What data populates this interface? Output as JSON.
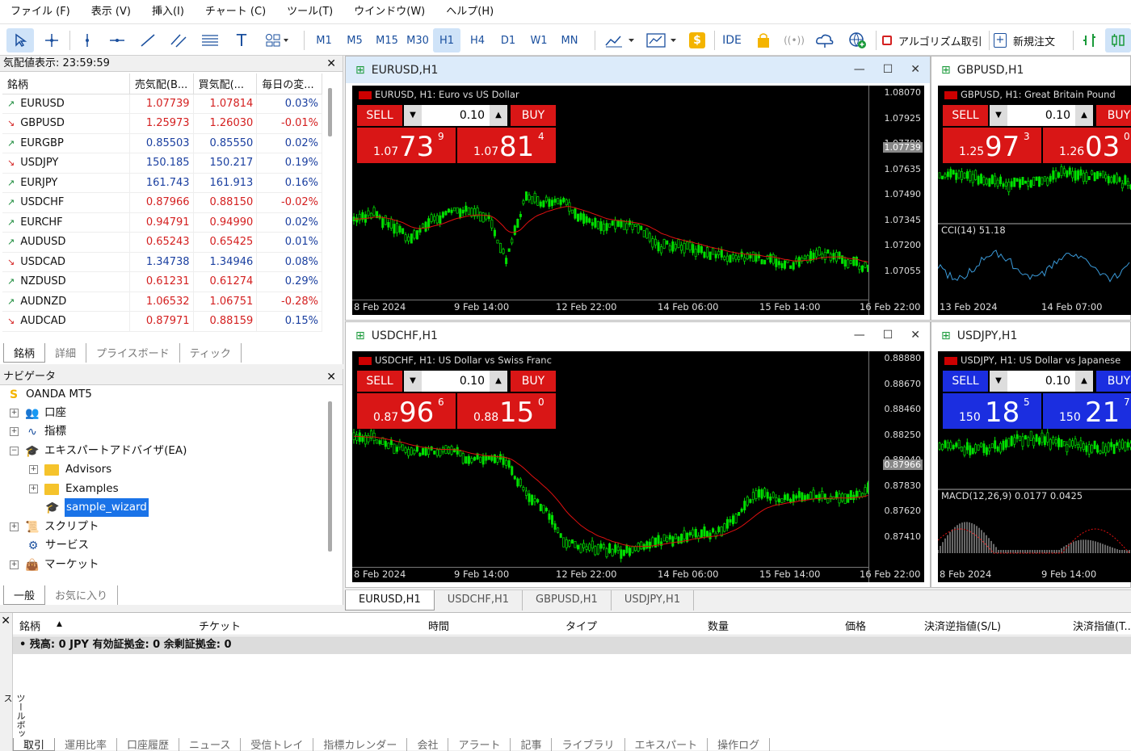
{
  "menu": [
    "ファイル (F)",
    "表示 (V)",
    "挿入(I)",
    "チャート (C)",
    "ツール(T)",
    "ウインドウ(W)",
    "ヘルプ(H)"
  ],
  "toolbar": {
    "timeframes": [
      "M1",
      "M5",
      "M15",
      "M30",
      "H1",
      "H4",
      "D1",
      "W1",
      "MN"
    ],
    "active_tf": "H1",
    "ide_label": "IDE",
    "algo_label": "アルゴリズム取引",
    "new_order_label": "新規注文",
    "accent": "#1a4f9e"
  },
  "watch": {
    "title": "気配値表示: 23:59:59",
    "headers": [
      "銘柄",
      "売気配(B...",
      "買気配(...",
      "毎日の変..."
    ],
    "rows": [
      {
        "dir": "up",
        "sym": "EURUSD",
        "bid": "1.07739",
        "ask": "1.07814",
        "chg": "0.03%"
      },
      {
        "dir": "dn",
        "sym": "GBPUSD",
        "bid": "1.25973",
        "ask": "1.26030",
        "chg": "-0.01%"
      },
      {
        "dir": "up",
        "sym": "EURGBP",
        "bid": "0.85503",
        "ask": "0.85550",
        "chg": "0.02%"
      },
      {
        "dir": "dn",
        "sym": "USDJPY",
        "bid": "150.185",
        "ask": "150.217",
        "chg": "0.19%"
      },
      {
        "dir": "up",
        "sym": "EURJPY",
        "bid": "161.743",
        "ask": "161.913",
        "chg": "0.16%"
      },
      {
        "dir": "up",
        "sym": "USDCHF",
        "bid": "0.87966",
        "ask": "0.88150",
        "chg": "-0.02%"
      },
      {
        "dir": "up",
        "sym": "EURCHF",
        "bid": "0.94791",
        "ask": "0.94990",
        "chg": "0.02%"
      },
      {
        "dir": "up",
        "sym": "AUDUSD",
        "bid": "0.65243",
        "ask": "0.65425",
        "chg": "0.01%"
      },
      {
        "dir": "dn",
        "sym": "USDCAD",
        "bid": "1.34738",
        "ask": "1.34946",
        "chg": "0.08%"
      },
      {
        "dir": "up",
        "sym": "NZDUSD",
        "bid": "0.61231",
        "ask": "0.61274",
        "chg": "0.29%"
      },
      {
        "dir": "up",
        "sym": "AUDNZD",
        "bid": "1.06532",
        "ask": "1.06751",
        "chg": "-0.28%"
      },
      {
        "dir": "dn",
        "sym": "AUDCAD",
        "bid": "0.87971",
        "ask": "0.88159",
        "chg": "0.15%"
      }
    ],
    "tabs": [
      "銘柄",
      "詳細",
      "プライスボード",
      "ティック"
    ]
  },
  "navigator": {
    "title": "ナビゲータ",
    "root": "OANDA MT5",
    "account": "口座",
    "indicators": "指標",
    "ea": "エキスパートアドバイザ(EA)",
    "advisors": "Advisors",
    "examples": "Examples",
    "wizard": "sample_wizard",
    "scripts": "スクリプト",
    "services": "サービス",
    "market": "マーケット",
    "tabs": [
      "一般",
      "お気に入り"
    ]
  },
  "charts": [
    {
      "title": "EURUSD,H1",
      "info": "EURUSD, H1:  Euro vs US Dollar",
      "lot": "0.10",
      "sell": "SELL",
      "buy": "BUY",
      "bid_sm": "1.07",
      "bid_big": "73",
      "bid_sup": "9",
      "ask_sm": "1.07",
      "ask_big": "81",
      "ask_sup": "4",
      "blue": false,
      "y": [
        "1.08070",
        "1.07925",
        "1.07780",
        "1.07635",
        "1.07490",
        "1.07345",
        "1.07200",
        "1.07055"
      ],
      "cur": "1.07739",
      "x": [
        "8 Feb 2024",
        "9 Feb 14:00",
        "12 Feb 22:00",
        "14 Feb 06:00",
        "15 Feb 14:00",
        "16 Feb 22:00"
      ],
      "sub": ""
    },
    {
      "title": "GBPUSD,H1",
      "info": "GBPUSD, H1:  Great Britain Pound",
      "lot": "0.10",
      "sell": "SELL",
      "buy": "BUY",
      "bid_sm": "1.25",
      "bid_big": "97",
      "bid_sup": "3",
      "ask_sm": "1.26",
      "ask_big": "03",
      "ask_sup": "0",
      "blue": false,
      "y": [],
      "cur": "",
      "x": [
        "13 Feb 2024",
        "14 Feb 07:00"
      ],
      "sub": "CCI(14) 51.18"
    },
    {
      "title": "USDCHF,H1",
      "info": "USDCHF, H1:  US Dollar vs Swiss Franc",
      "lot": "0.10",
      "sell": "SELL",
      "buy": "BUY",
      "bid_sm": "0.87",
      "bid_big": "96",
      "bid_sup": "6",
      "ask_sm": "0.88",
      "ask_big": "15",
      "ask_sup": "0",
      "blue": false,
      "y": [
        "0.88880",
        "0.88670",
        "0.88460",
        "0.88250",
        "0.88040",
        "0.87830",
        "0.87620",
        "0.87410"
      ],
      "cur": "0.87966",
      "x": [
        "8 Feb 2024",
        "9 Feb 14:00",
        "12 Feb 22:00",
        "14 Feb 06:00",
        "15 Feb 14:00",
        "16 Feb 22:00"
      ],
      "sub": ""
    },
    {
      "title": "USDJPY,H1",
      "info": "USDJPY, H1:  US Dollar vs Japanese",
      "lot": "0.10",
      "sell": "SELL",
      "buy": "BUY",
      "bid_sm": "150",
      "bid_big": "18",
      "bid_sup": "5",
      "ask_sm": "150",
      "ask_big": "21",
      "ask_sup": "7",
      "blue": true,
      "y": [],
      "cur": "",
      "x": [
        "8 Feb 2024",
        "9 Feb 14:00"
      ],
      "sub": "MACD(12,26,9) 0.0177 0.0425"
    }
  ],
  "chart_tabs": [
    "EURUSD,H1",
    "USDCHF,H1",
    "GBPUSD,H1",
    "USDJPY,H1"
  ],
  "toolbox": {
    "side_label": "ツールボックス",
    "cols": [
      "銘柄",
      "チケット",
      "時間",
      "タイプ",
      "数量",
      "価格",
      "決済逆指値(S/L)",
      "決済指値(T..."
    ],
    "balance": "残高: 0 JPY  有効証拠金: 0  余剰証拠金: 0",
    "tabs": [
      "取引",
      "運用比率",
      "口座履歴",
      "ニュース",
      "受信トレイ",
      "指標カレンダー",
      "会社",
      "アラート",
      "記事",
      "ライブラリ",
      "エキスパート",
      "操作ログ"
    ]
  }
}
